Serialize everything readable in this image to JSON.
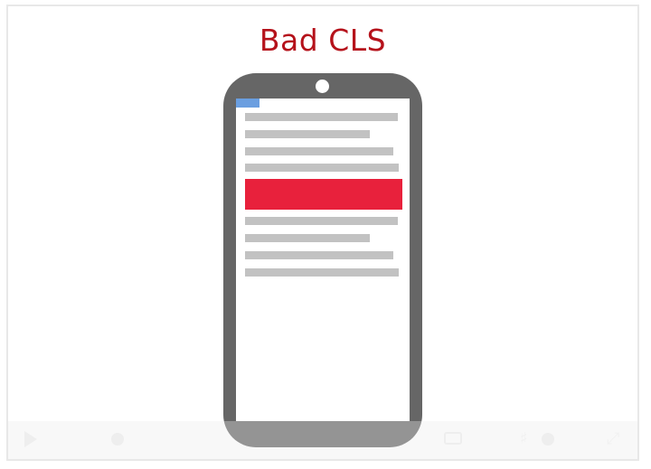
{
  "slide": {
    "title": "Bad CLS",
    "title_color": "#b5121b"
  },
  "phone": {
    "body_color": "#666666",
    "status_chip_color": "#6a9ee0",
    "ad_color": "#e8213c",
    "text_line_color": "#c2c2c2"
  },
  "player_controls": {
    "icons": [
      "play-icon",
      "scrub-knob",
      "closed-captions-icon",
      "volume-icon",
      "volume-knob",
      "fullscreen-icon"
    ]
  }
}
